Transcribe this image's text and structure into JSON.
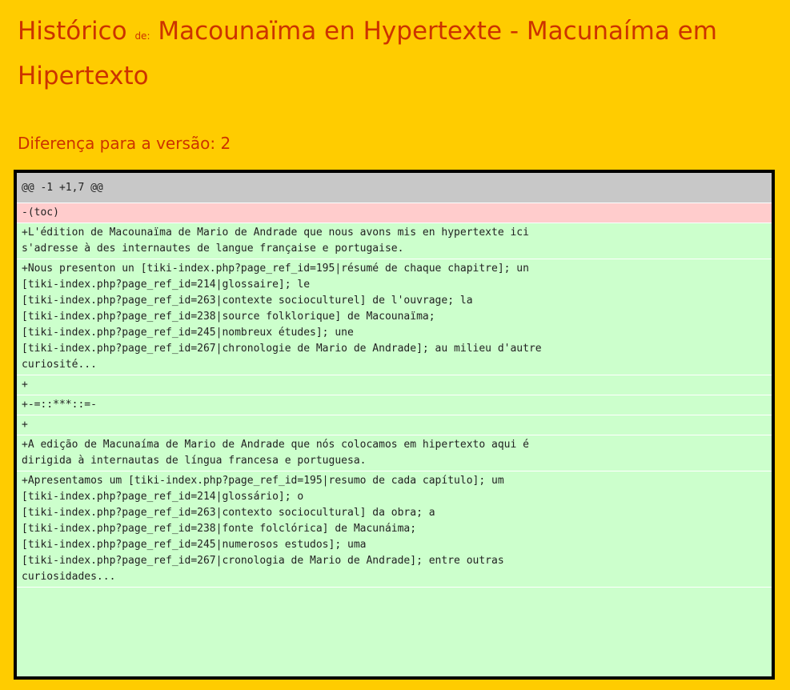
{
  "header": {
    "title_prefix": "Histórico",
    "title_de": "de:",
    "title_main": "Macounaïma en Hypertexte - Macunaíma em Hipertexto",
    "subtitle": "Diferença para a versão: 2"
  },
  "diff": {
    "hunk": "@@ -1 +1,7 @@",
    "lines": [
      {
        "type": "del",
        "text": "-(toc)"
      },
      {
        "type": "add",
        "text": "+L'édition de Macounaïma de Mario de Andrade que nous avons mis en hypertexte ici\ns'adresse à des internautes de langue française e portugaise."
      },
      {
        "type": "add",
        "text": "+Nous presenton un [tiki-index.php?page_ref_id=195|résumé de chaque chapitre]; un\n[tiki-index.php?page_ref_id=214|glossaire]; le\n[tiki-index.php?page_ref_id=263|contexte socioculturel] de l'ouvrage; la\n[tiki-index.php?page_ref_id=238|source folklorique] de Macounaïma;\n[tiki-index.php?page_ref_id=245|nombreux études]; une\n[tiki-index.php?page_ref_id=267|chronologie de Mario de Andrade]; au milieu d'autre\ncuriosité..."
      },
      {
        "type": "add",
        "text": "+"
      },
      {
        "type": "add",
        "text": "+-=::***::=-"
      },
      {
        "type": "add",
        "text": "+"
      },
      {
        "type": "add",
        "text": "+A edição de Macunaíma de Mario de Andrade que nós colocamos em hipertexto aqui é\ndirigida à internautas de língua francesa e portuguesa."
      },
      {
        "type": "add",
        "text": "+Apresentamos um [tiki-index.php?page_ref_id=195|resumo de cada capítulo]; um\n[tiki-index.php?page_ref_id=214|glossário]; o\n[tiki-index.php?page_ref_id=263|contexto sociocultural] da obra; a\n[tiki-index.php?page_ref_id=238|fonte folclórica] de Macunáima;\n[tiki-index.php?page_ref_id=245|numerosos estudos]; uma\n[tiki-index.php?page_ref_id=267|cronologia de Mario de Andrade]; entre outras\ncuriosidades..."
      }
    ]
  }
}
